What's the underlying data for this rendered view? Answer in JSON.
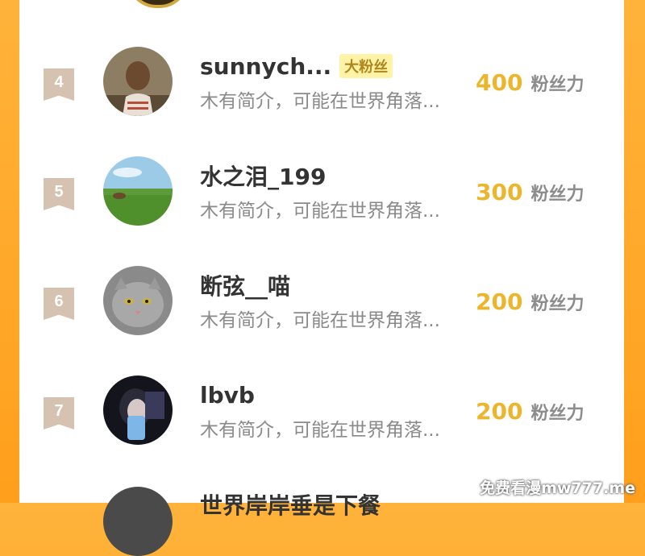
{
  "rows": [
    {
      "rank": "4",
      "name": "sunnych...",
      "badge": "大粉丝",
      "bio": "木有简介，可能在世界角落...",
      "score": "400",
      "score_unit": "粉丝力"
    },
    {
      "rank": "5",
      "name": "水之泪_199",
      "badge": "",
      "bio": "木有简介，可能在世界角落...",
      "score": "300",
      "score_unit": "粉丝力"
    },
    {
      "rank": "6",
      "name": "断弦__喵",
      "badge": "",
      "bio": "木有简介，可能在世界角落...",
      "score": "200",
      "score_unit": "粉丝力"
    },
    {
      "rank": "7",
      "name": "lbvb",
      "badge": "",
      "bio": "木有简介，可能在世界角落...",
      "score": "200",
      "score_unit": "粉丝力"
    }
  ],
  "partial_row": {
    "name": "世界岸岸垂是下餐"
  },
  "watermark": "免费看漫mw777.me",
  "colors": {
    "background": "#ff9f1c",
    "score": "#ecb52b",
    "badge_bg": "#fff3a8",
    "rank_ribbon": "#d5c2b1"
  }
}
